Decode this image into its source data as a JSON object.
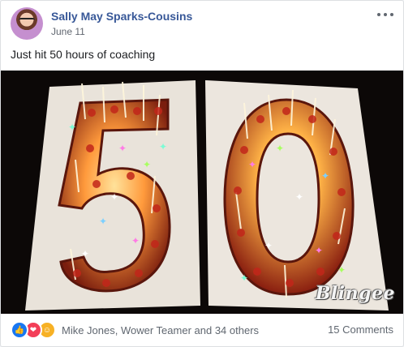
{
  "post": {
    "author": "Sally May Sparks-Cousins",
    "date": "June 11",
    "text": "Just hit 50 hours of coaching",
    "image": {
      "watermark": "Blingee"
    }
  },
  "footer": {
    "reaction_icons": [
      "like-icon",
      "love-icon",
      "care-icon"
    ],
    "reactions_summary": "Mike Jones, Wower Teamer and 34 others",
    "comments": "15 Comments"
  },
  "colors": {
    "author_link": "#385898",
    "like_blue": "#1877f2",
    "love_red": "#f33e58",
    "care_yellow": "#f7b125"
  }
}
